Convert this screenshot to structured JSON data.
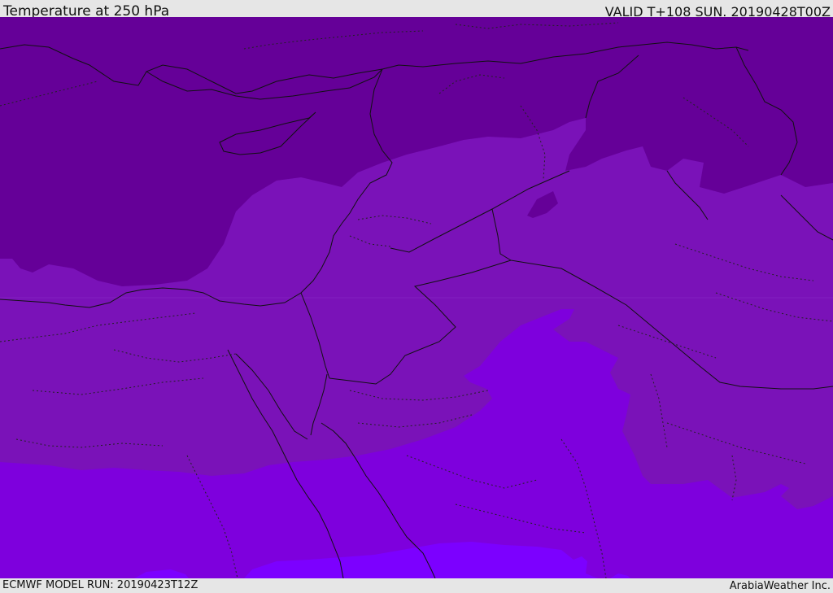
{
  "header": {
    "title": "Temperature at 250 hPa",
    "valid_time": "VALID T+108 SUN. 20190428T00Z"
  },
  "footer": {
    "model_run": "ECMWF MODEL RUN: 20190423T12Z",
    "credit": "ArabiaWeather Inc."
  },
  "map": {
    "field": "temperature",
    "level": "250 hPa",
    "colors": {
      "coldest": "#650098",
      "cold": "#7a12b8",
      "mid": "#7e00dd",
      "warm": "#7c00ff",
      "border_solid": "#111111",
      "border_dotted": "#222222"
    }
  }
}
